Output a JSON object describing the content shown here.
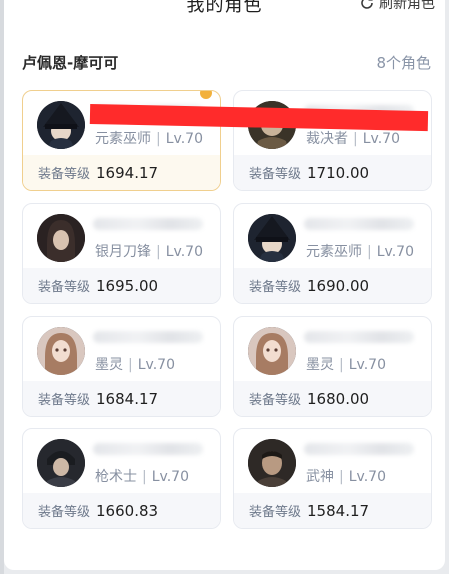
{
  "header": {
    "title": "我的角色",
    "refresh_label": "刷新角色"
  },
  "group": {
    "name": "卢佩恩-摩可可",
    "count": "8个角色"
  },
  "level_label": "装备等级",
  "characters": [
    {
      "class": "元素巫师",
      "level": "Lv.70",
      "gear": "1694.17",
      "selected": true,
      "avatar": "witch-hat"
    },
    {
      "class": "裁决者",
      "level": "Lv.70",
      "gear": "1710.00",
      "selected": false,
      "avatar": "warrior"
    },
    {
      "class": "银月刀锋",
      "level": "Lv.70",
      "gear": "1695.00",
      "selected": false,
      "avatar": "hooded"
    },
    {
      "class": "元素巫师",
      "level": "Lv.70",
      "gear": "1690.00",
      "selected": false,
      "avatar": "witch-hat"
    },
    {
      "class": "墨灵",
      "level": "Lv.70",
      "gear": "1684.17",
      "selected": false,
      "avatar": "girl"
    },
    {
      "class": "墨灵",
      "level": "Lv.70",
      "gear": "1680.00",
      "selected": false,
      "avatar": "girl"
    },
    {
      "class": "枪术士",
      "level": "Lv.70",
      "gear": "1660.83",
      "selected": false,
      "avatar": "gunner"
    },
    {
      "class": "武神",
      "level": "Lv.70",
      "gear": "1584.17",
      "selected": false,
      "avatar": "monk"
    }
  ],
  "colors": {
    "accent_border": "#f0cf8e",
    "muted_text": "#8790a1",
    "redaction": "#ff2b2b"
  }
}
